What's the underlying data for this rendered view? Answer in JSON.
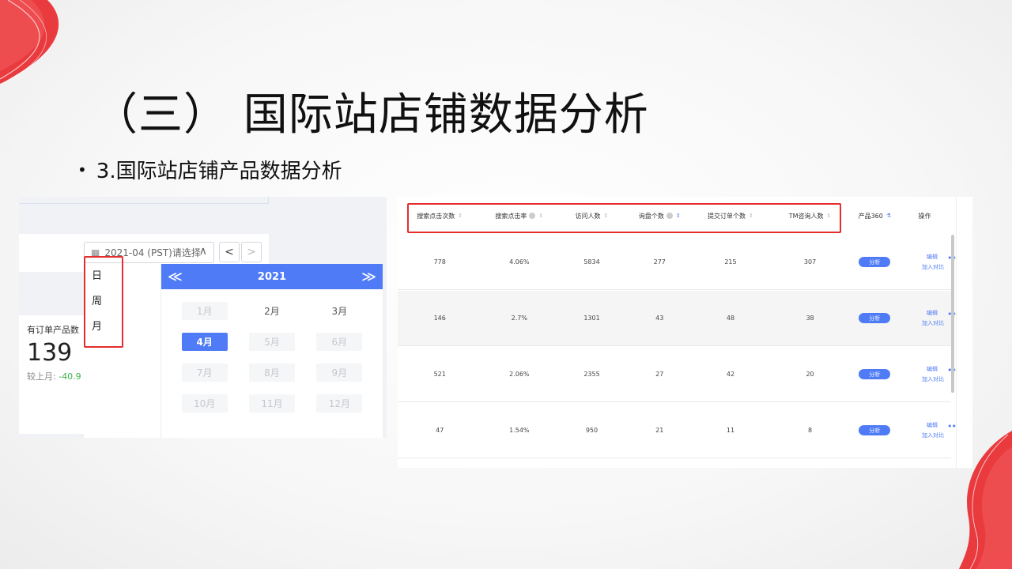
{
  "slide": {
    "title": "（三） 国际站店铺数据分析",
    "bullet": "3.国际站店铺产品数据分析"
  },
  "colors": {
    "accent": "#4f7cf6",
    "highlight_box": "#e52d2d",
    "negative": "#3db34a"
  },
  "left_shot": {
    "picker": {
      "value": "2021-04 (PST)请选择",
      "icon": "calendar-icon",
      "caret": "∧"
    },
    "nav": {
      "prev": "<",
      "next": ">"
    },
    "granularity_options": [
      "日",
      "周",
      "月"
    ],
    "calendar": {
      "year": "2021",
      "prev_glyph": "≪",
      "next_glyph": "≫",
      "months": [
        "1月",
        "2月",
        "3月",
        "4月",
        "5月",
        "6月",
        "7月",
        "8月",
        "9月",
        "10月",
        "11月",
        "12月"
      ],
      "selected": "4月"
    },
    "metric_card": {
      "label": "有订单产品数",
      "value": "139",
      "compare_label": "较上月:",
      "compare_value": "-40.9"
    }
  },
  "right_shot": {
    "headers": [
      "搜索点击次数",
      "搜索点击率",
      "访问人数",
      "询盘个数",
      "提交订单个数",
      "TM咨询人数",
      "产品360",
      "操作"
    ],
    "rows": [
      {
        "cells": [
          "778",
          "4.06%",
          "5834",
          "277",
          "215",
          "307"
        ]
      },
      {
        "cells": [
          "146",
          "2.7%",
          "1301",
          "43",
          "48",
          "38"
        ]
      },
      {
        "cells": [
          "521",
          "2.06%",
          "2355",
          "27",
          "42",
          "20"
        ]
      },
      {
        "cells": [
          "47",
          "1.54%",
          "950",
          "21",
          "11",
          "8"
        ]
      }
    ],
    "analyze_label": "分析",
    "edit_label": "编辑",
    "compare_label": "加入对比",
    "more_glyph": "•••"
  }
}
